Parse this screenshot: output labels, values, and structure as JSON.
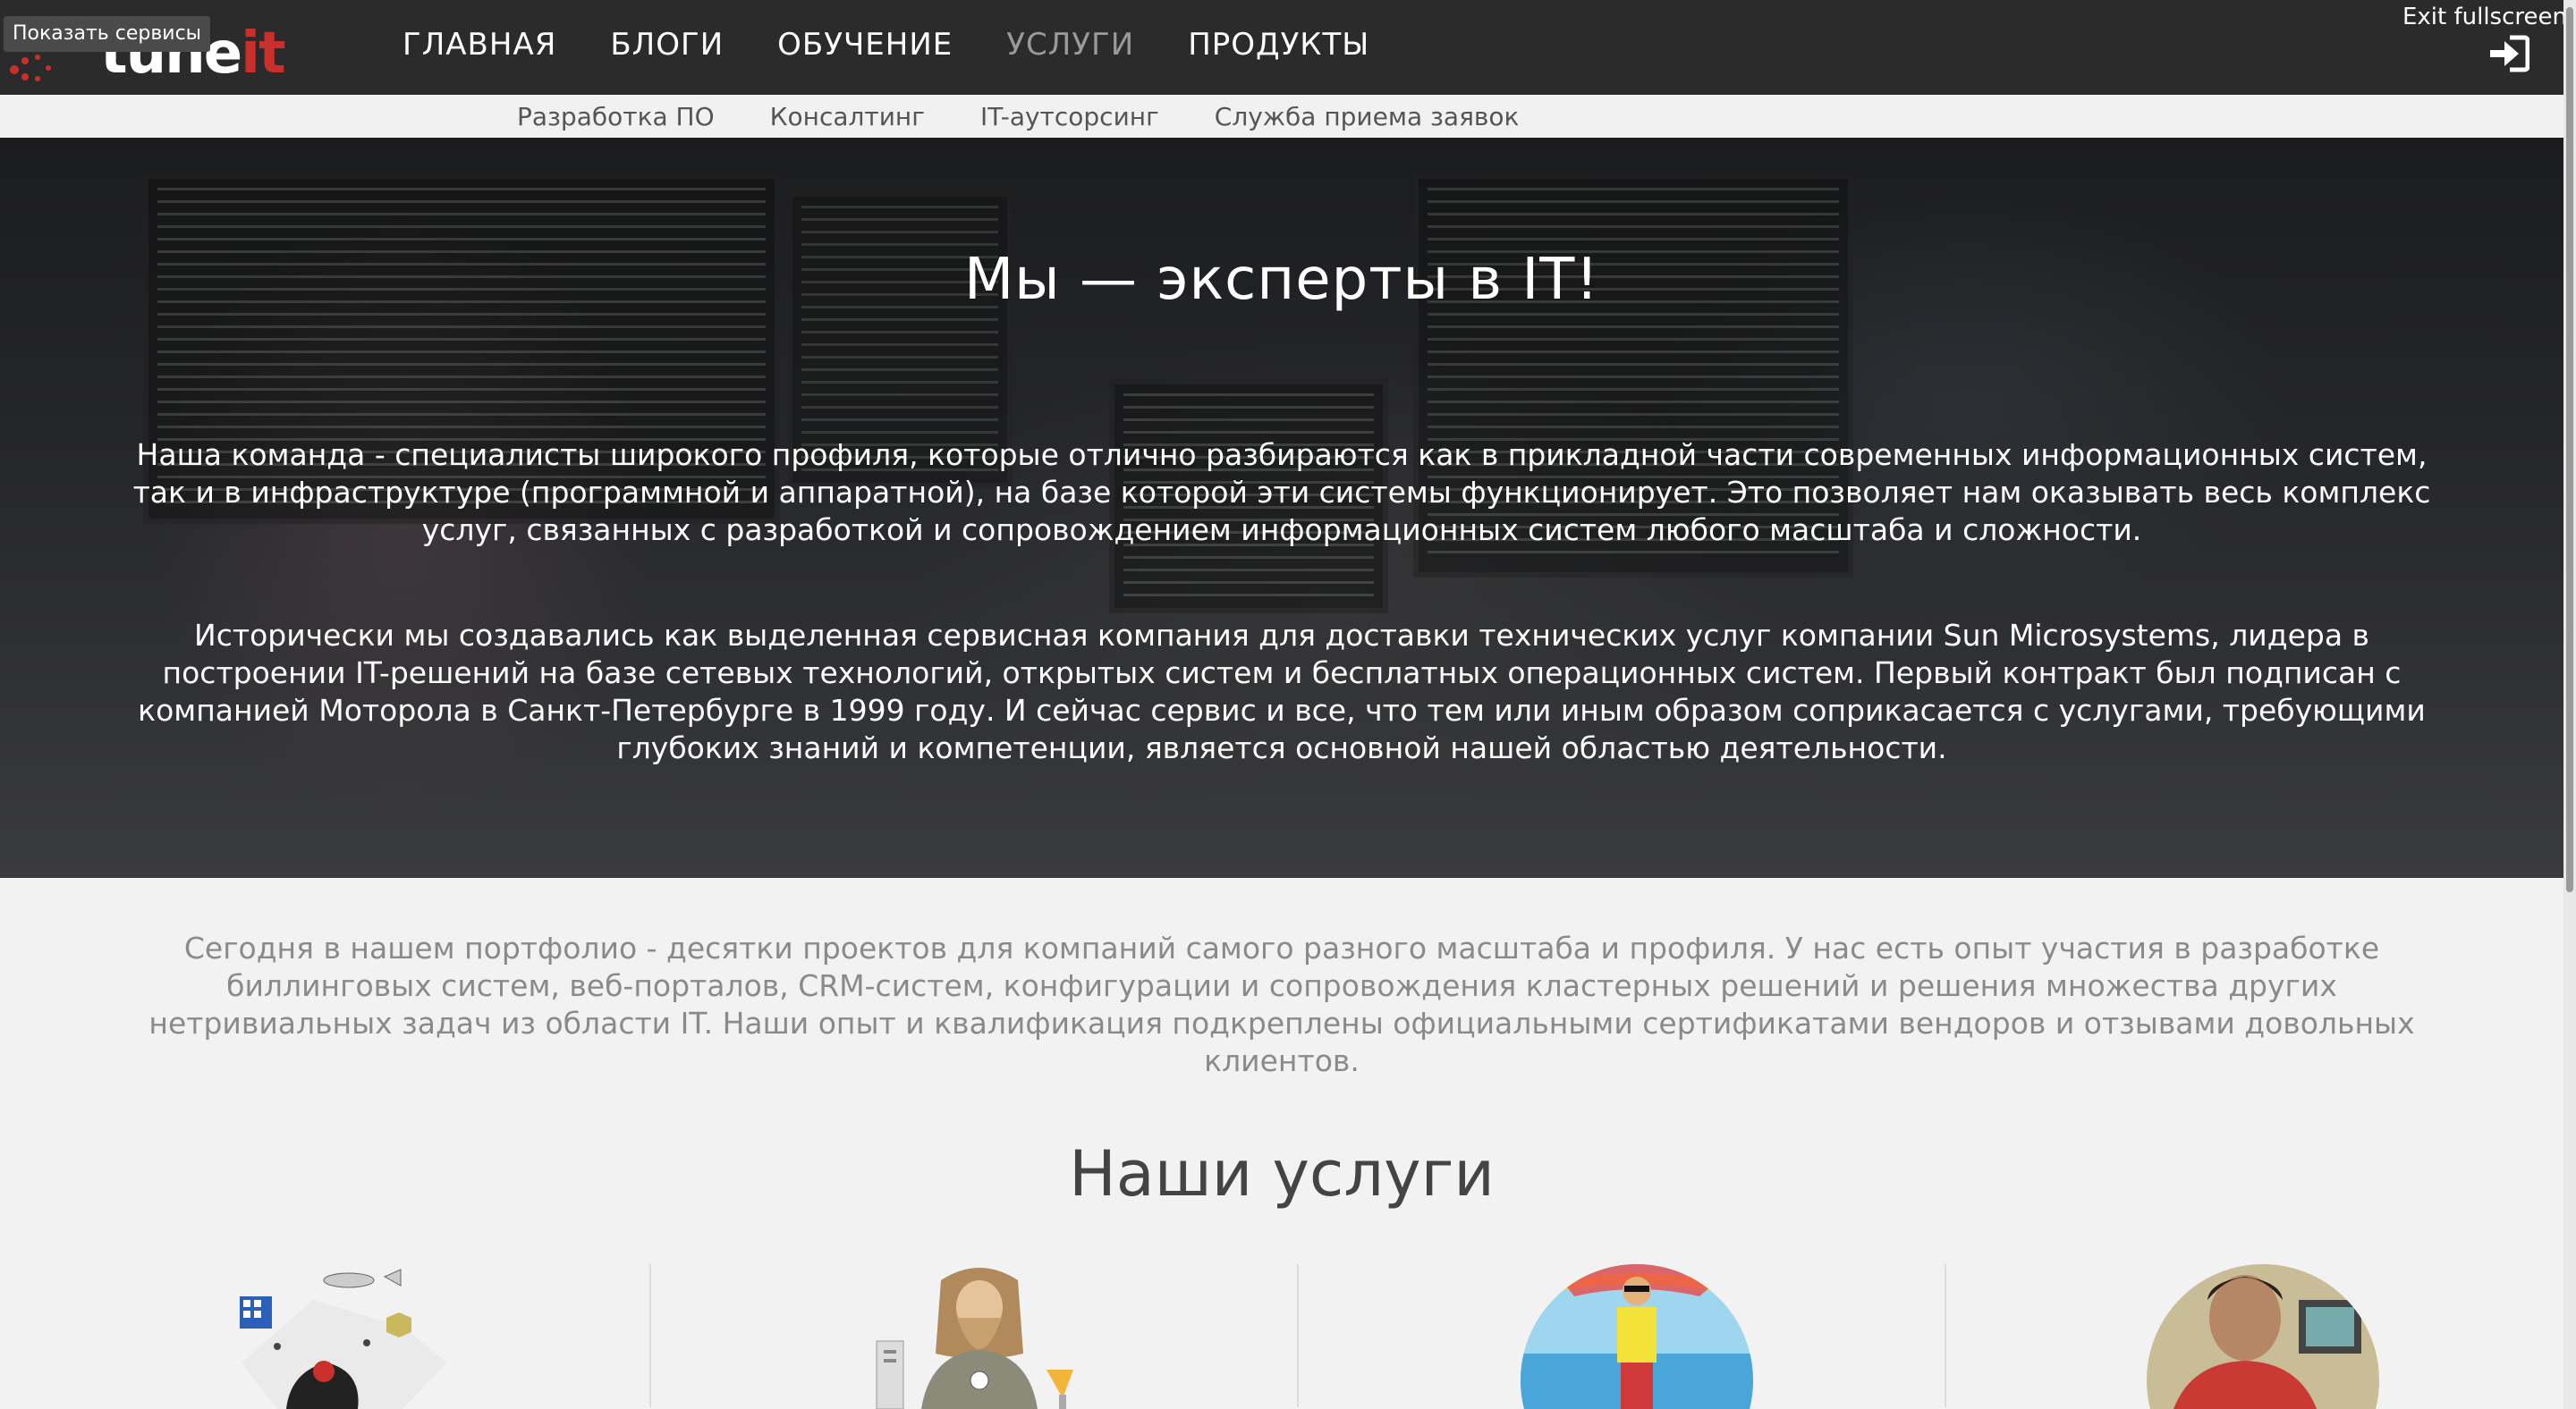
{
  "topbar": {
    "services_button": "Показать сервисы",
    "logo_part1": "tune",
    "logo_part2": "it",
    "exit_fullscreen": "Exit fullscreen",
    "nav": [
      {
        "label": "ГЛАВНАЯ",
        "active": false
      },
      {
        "label": "БЛОГИ",
        "active": false
      },
      {
        "label": "ОБУЧЕНИЕ",
        "active": false
      },
      {
        "label": "УСЛУГИ",
        "active": true
      },
      {
        "label": "ПРОДУКТЫ",
        "active": false
      }
    ]
  },
  "subnav": [
    {
      "label": "Разработка ПО"
    },
    {
      "label": "Консалтинг"
    },
    {
      "label": "IT-аутсорсинг"
    },
    {
      "label": "Служба приема заявок"
    }
  ],
  "hero": {
    "title": "Мы — эксперты в IT!",
    "paragraph1": "Наша команда - специалисты широкого профиля, которые отлично разбираются как в прикладной части современных информационных систем, так и в инфраструктуре (программной и аппаратной), на базе которой эти системы функционирует. Это позволяет нам оказывать весь комплекс услуг, связанных с разработкой и сопровождением информационных систем любого масштаба и сложности.",
    "paragraph2": "Исторически мы создавались как выделенная сервисная компания для доставки технических услуг компании Sun Microsystems, лидера в построении IT-решений на базе сетевых технологий, открытых систем и бесплатных операционных систем. Первый контракт был подписан с компанией Моторола в Санкт-Петербурге в 1999 году. И сейчас сервис и все, что тем или иным образом соприкасается с услугами, требующими глубоких знаний и компетенции, является основной нашей областью деятельности."
  },
  "portfolio_text": "Сегодня в нашем портфолио - десятки проектов для компаний самого разного масштаба и профиля. У нас есть опыт участия в разработке биллинговых систем, веб-порталов, CRM-систем, конфигурации и сопровождения кластерных решений и решения множества других нетривиальных задач из области IT. Наши опыт и квалификация подкреплены официальными сертификатами вендоров и отзывами довольных клиентов.",
  "services": {
    "title": "Наши услуги",
    "cards": [
      {
        "icon": "juggler-development-illustration"
      },
      {
        "icon": "meditating-guru-illustration"
      },
      {
        "icon": "beach-outsourcing-illustration"
      },
      {
        "icon": "support-person-photo"
      }
    ]
  },
  "colors": {
    "topbar": "#2b2b2b",
    "brand_red": "#c9302c",
    "active_nav": "#9a9a9a"
  }
}
